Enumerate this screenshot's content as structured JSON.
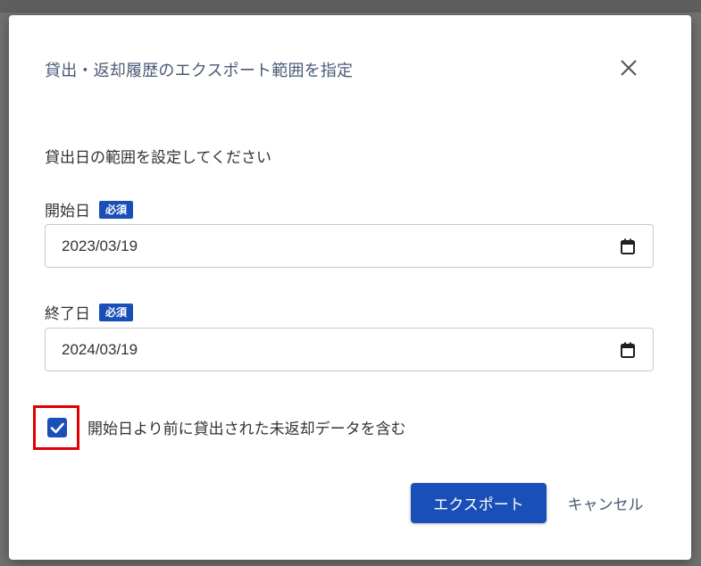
{
  "dialog": {
    "title": "貸出・返却履歴のエクスポート範囲を指定",
    "close_icon": "close-icon",
    "instruction": "貸出日の範囲を設定してください",
    "start_date": {
      "label": "開始日",
      "required_badge": "必須",
      "value": "2023/03/19",
      "icon": "calendar-icon"
    },
    "end_date": {
      "label": "終了日",
      "required_badge": "必須",
      "value": "2024/03/19",
      "icon": "calendar-icon"
    },
    "include_unreturned": {
      "checked": true,
      "label": "開始日より前に貸出された未返却データを含む"
    },
    "export_label": "エクスポート",
    "cancel_label": "キャンセル"
  },
  "colors": {
    "primary": "#1a4fb8",
    "highlight": "#e00000",
    "title_text": "#4a5a75",
    "body_text": "#333333"
  }
}
